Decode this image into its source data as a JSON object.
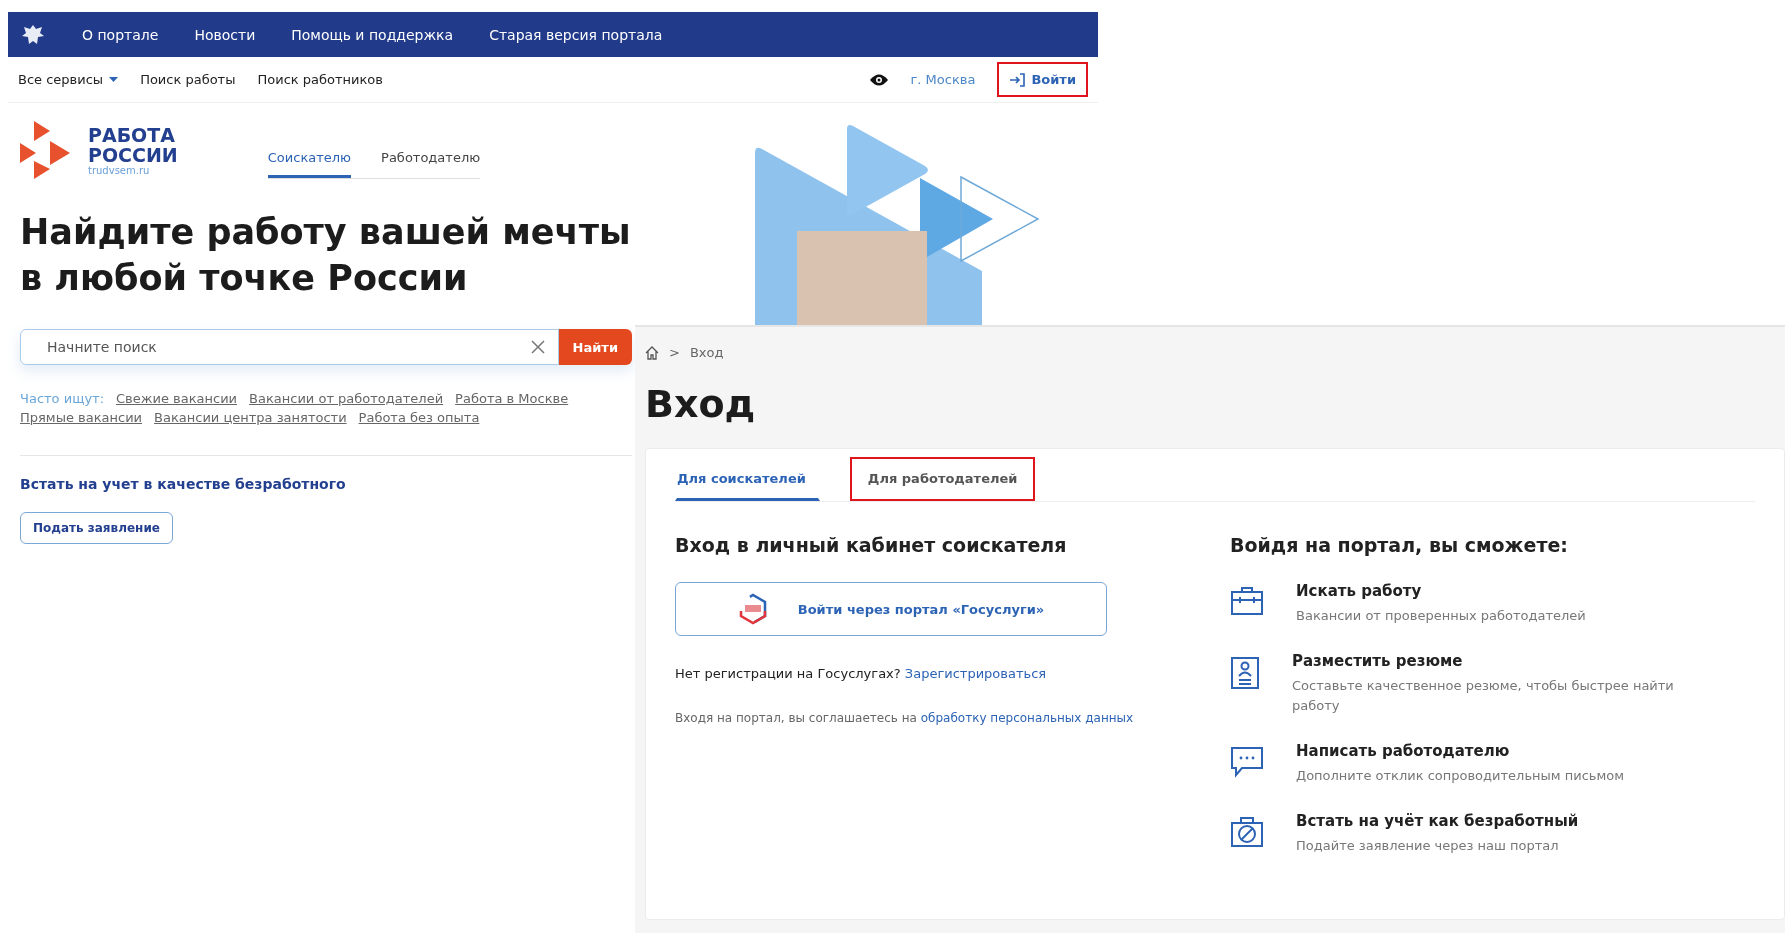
{
  "top_nav": {
    "items": [
      "О портале",
      "Новости",
      "Помощь и поддержка",
      "Старая версия портала"
    ]
  },
  "sub_nav": {
    "items": [
      {
        "label": "Все сервисы",
        "kind": "dropdown"
      },
      {
        "label": "Поиск работы",
        "kind": "link"
      },
      {
        "label": "Поиск работников",
        "kind": "link"
      }
    ],
    "city": "г. Москва",
    "login": {
      "label": "Войти",
      "highlighted": true
    }
  },
  "logo": {
    "title_lines": [
      "РАБОТА",
      "РОССИИ"
    ],
    "domain": "trudvsem.ru"
  },
  "audience_tabs": [
    {
      "label": "Соискателю",
      "selected": true
    },
    {
      "label": "Работодателю",
      "selected": false
    }
  ],
  "hero": {
    "heading_lines": [
      "Найдите работу вашей мечты",
      "в любой точке России"
    ]
  },
  "search": {
    "placeholder": "Начните поиск",
    "button": "Найти"
  },
  "popular": {
    "label": "Часто ищут:",
    "links": [
      "Свежие вакансии",
      "Вакансии от работодателей",
      "Работа в Москве",
      "Прямые вакансии",
      "Вакансии центра занятости",
      "Работа без опыта"
    ]
  },
  "unemployed": {
    "title": "Встать на учет в качестве безработного",
    "button": "Подать заявление"
  },
  "login_page": {
    "breadcrumb_separator": ">",
    "breadcrumb": [
      "Вход"
    ],
    "title": "Вход",
    "tabs": [
      {
        "label": "Для соискателей",
        "selected": true,
        "highlighted": false
      },
      {
        "label": "Для работодателей",
        "selected": false,
        "highlighted": true
      }
    ],
    "heading": "Вход в личный кабинет соискателя",
    "gosuslugi_button": "Войти через портал «Госуслуги»",
    "register": {
      "text": "Нет регистрации на Госуслугах?",
      "link": "Зарегистрироваться"
    },
    "consent": {
      "text": "Входя на портал, вы соглашаетесь на",
      "link": "обработку персональных данных"
    },
    "benefits_title": "Войдя на портал, вы сможете:",
    "benefits": [
      {
        "kind": "briefcase",
        "title": "Искать работу",
        "text": "Вакансии от проверенных работодателей"
      },
      {
        "kind": "resume",
        "title": "Разместить резюме",
        "text": "Составьте качественное резюме, чтобы быстрее найти работу"
      },
      {
        "kind": "chat",
        "title": "Написать работодателю",
        "text": "Дополните отклик сопроводительным письмом"
      },
      {
        "kind": "unemployed",
        "title": "Встать на учёт как безработный",
        "text": "Подайте заявление через наш портал"
      }
    ]
  }
}
